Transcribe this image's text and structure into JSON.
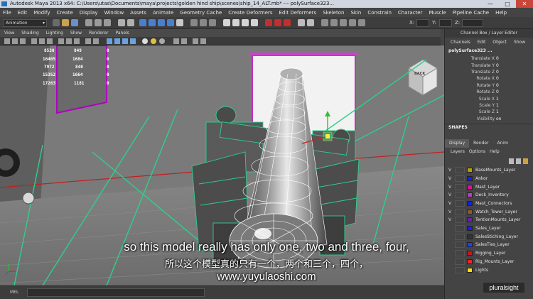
{
  "window": {
    "title": "Autodesk Maya 2013 x64: C:\\Users\\utas\\Documents\\maya\\projects\\golden hind ship\\scenes\\ship_14_ALT.mb*  ---  polySurface323...",
    "min": "—",
    "max": "□",
    "close": "✕"
  },
  "menubar": [
    "File",
    "Edit",
    "Modify",
    "Create",
    "Display",
    "Window",
    "Assets",
    "Animate",
    "Geometry Cache",
    "Create Deformers",
    "Edit Deformers",
    "Skeleton",
    "Skin",
    "Constrain",
    "Character",
    "Muscle",
    "Pipeline Cache",
    "Help"
  ],
  "statusline": {
    "mode": "Animation",
    "x_label": "X:",
    "y_label": "Y:",
    "z_label": "Z:"
  },
  "panel_menu": [
    "View",
    "Shading",
    "Lighting",
    "Show",
    "Renderer",
    "Panels"
  ],
  "hud": {
    "rows": [
      [
        "8530",
        "849",
        "0"
      ],
      [
        "16405",
        "1684",
        "0"
      ],
      [
        "7972",
        "840",
        "0"
      ],
      [
        "15352",
        "1664",
        "0"
      ],
      [
        "17263",
        "1181",
        "0"
      ]
    ]
  },
  "viewcube": {
    "label": "BACK"
  },
  "channel_box": {
    "title": "Channel Box / Layer Editor",
    "menu": [
      "Channels",
      "Edit",
      "Object",
      "Show"
    ],
    "object": "polySurface323 ...",
    "channels": [
      {
        "name": "Translate X",
        "value": "0"
      },
      {
        "name": "Translate Y",
        "value": "0"
      },
      {
        "name": "Translate Z",
        "value": "0"
      },
      {
        "name": "Rotate X",
        "value": "0"
      },
      {
        "name": "Rotate Y",
        "value": "0"
      },
      {
        "name": "Rotate Z",
        "value": "0"
      },
      {
        "name": "Scale X",
        "value": "1"
      },
      {
        "name": "Scale Y",
        "value": "1"
      },
      {
        "name": "Scale Z",
        "value": "1"
      },
      {
        "name": "Visibility",
        "value": "on"
      }
    ],
    "shapes": "SHAPES"
  },
  "layer_editor": {
    "tabs": [
      "Display",
      "Render",
      "Anim"
    ],
    "menu": [
      "Layers",
      "Options",
      "Help"
    ],
    "layers": [
      {
        "vis": "V",
        "name": "BaseMounts_Layer",
        "color": "#b8a000"
      },
      {
        "vis": "V",
        "name": "Ankor",
        "color": "#1a1aff"
      },
      {
        "vis": "V",
        "name": "Mast_Layer",
        "color": "#e0109a"
      },
      {
        "vis": "V",
        "name": "Deck_Inventory",
        "color": "#b040c0"
      },
      {
        "vis": "V",
        "name": "Mast_Connectors",
        "color": "#1520d8"
      },
      {
        "vis": "V",
        "name": "Watch_Tower_Layer",
        "color": "#8a5a30"
      },
      {
        "vis": "V",
        "name": "TentionMounts_Layer",
        "color": "#6a20b0"
      },
      {
        "vis": "",
        "name": "Sales_Layer",
        "color": "#1a1aff"
      },
      {
        "vis": "",
        "name": "SalesStiching_Layer",
        "color": "#333333"
      },
      {
        "vis": "",
        "name": "SalesTies_Layer",
        "color": "#2040ff"
      },
      {
        "vis": "",
        "name": "Rigging_Layer",
        "color": "#d01020"
      },
      {
        "vis": "",
        "name": "Rig_Mounts_Layer",
        "color": "#ff2020"
      },
      {
        "vis": "",
        "name": "Lights",
        "color": "#ffe000"
      }
    ]
  },
  "command_line": {
    "label": "MEL"
  },
  "subtitles": {
    "english": "so this model really has only one, two and three, four,",
    "chinese": "所以这个模型真的只有一个，两个和三个，四个，",
    "url": "www.yuyulaoshi.com"
  },
  "watermark": "pluralsight",
  "colors": {
    "wireframe": "#2ecf8e",
    "selection_highlight": "#ffffff",
    "background": "#777777"
  }
}
